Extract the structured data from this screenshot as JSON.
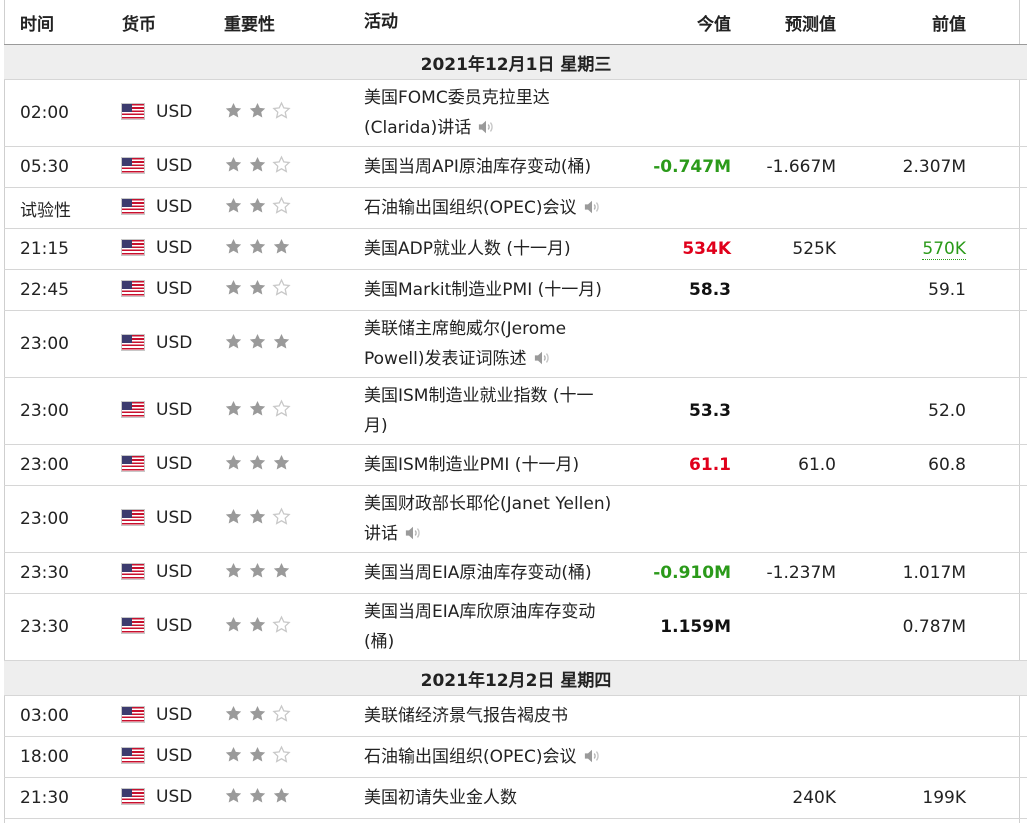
{
  "header": {
    "time": "时间",
    "currency": "货币",
    "importance": "重要性",
    "event": "活动",
    "actual": "今值",
    "forecast": "预测值",
    "previous": "前值"
  },
  "icons": {
    "flag": "us-flag-icon",
    "star_full": "star-filled-icon",
    "star_empty": "star-outline-icon",
    "speaker": "speaker-icon"
  },
  "colors": {
    "red": "#e0001b",
    "green": "#2b9a1a",
    "star_filled": "#9a9a9a",
    "star_empty": "#c8c8c8",
    "date_bg": "#eeeeee"
  },
  "sections": [
    {
      "date": "2021年12月1日  星期三",
      "rows": [
        {
          "time": "02:00",
          "currency": "USD",
          "stars": 2,
          "event": [
            "美国FOMC委员克拉里达",
            "(Clarida)讲话"
          ],
          "speech": true,
          "actual": "",
          "actual_color": "",
          "forecast": "",
          "previous": "",
          "previous_color": ""
        },
        {
          "time": "05:30",
          "currency": "USD",
          "stars": 2,
          "event": [
            "美国当周API原油库存变动(桶)"
          ],
          "speech": false,
          "actual": "-0.747M",
          "actual_color": "green",
          "forecast": "-1.667M",
          "previous": "2.307M",
          "previous_color": ""
        },
        {
          "time": "试验性",
          "currency": "USD",
          "stars": 2,
          "event": [
            "石油输出国组织(OPEC)会议"
          ],
          "speech": true,
          "actual": "",
          "actual_color": "",
          "forecast": "",
          "previous": "",
          "previous_color": ""
        },
        {
          "time": "21:15",
          "currency": "USD",
          "stars": 3,
          "event": [
            "美国ADP就业人数 (十一月)"
          ],
          "speech": false,
          "actual": "534K",
          "actual_color": "red",
          "forecast": "525K",
          "previous": "570K",
          "previous_color": "green-dotted"
        },
        {
          "time": "22:45",
          "currency": "USD",
          "stars": 2,
          "event": [
            "美国Markit制造业PMI (十一月)"
          ],
          "speech": false,
          "actual": "58.3",
          "actual_color": "black",
          "forecast": "",
          "previous": "59.1",
          "previous_color": ""
        },
        {
          "time": "23:00",
          "currency": "USD",
          "stars": 3,
          "event": [
            "美联储主席鲍威尔(Jerome",
            "Powell)发表证词陈述"
          ],
          "speech": true,
          "actual": "",
          "actual_color": "",
          "forecast": "",
          "previous": "",
          "previous_color": ""
        },
        {
          "time": "23:00",
          "currency": "USD",
          "stars": 2,
          "event": [
            "美国ISM制造业就业指数 (十一",
            "月)"
          ],
          "speech": false,
          "actual": "53.3",
          "actual_color": "black",
          "forecast": "",
          "previous": "52.0",
          "previous_color": ""
        },
        {
          "time": "23:00",
          "currency": "USD",
          "stars": 3,
          "event": [
            "美国ISM制造业PMI (十一月)"
          ],
          "speech": false,
          "actual": "61.1",
          "actual_color": "red",
          "forecast": "61.0",
          "previous": "60.8",
          "previous_color": ""
        },
        {
          "time": "23:00",
          "currency": "USD",
          "stars": 2,
          "event": [
            "美国财政部长耶伦(Janet Yellen)",
            "讲话"
          ],
          "speech": true,
          "actual": "",
          "actual_color": "",
          "forecast": "",
          "previous": "",
          "previous_color": ""
        },
        {
          "time": "23:30",
          "currency": "USD",
          "stars": 3,
          "event": [
            "美国当周EIA原油库存变动(桶)"
          ],
          "speech": false,
          "actual": "-0.910M",
          "actual_color": "green",
          "forecast": "-1.237M",
          "previous": "1.017M",
          "previous_color": ""
        },
        {
          "time": "23:30",
          "currency": "USD",
          "stars": 2,
          "event": [
            "美国当周EIA库欣原油库存变动",
            "(桶)"
          ],
          "speech": false,
          "actual": "1.159M",
          "actual_color": "black",
          "forecast": "",
          "previous": "0.787M",
          "previous_color": ""
        }
      ]
    },
    {
      "date": "2021年12月2日  星期四",
      "rows": [
        {
          "time": "03:00",
          "currency": "USD",
          "stars": 2,
          "event": [
            "美联储经济景气报告褐皮书"
          ],
          "speech": false,
          "actual": "",
          "actual_color": "",
          "forecast": "",
          "previous": "",
          "previous_color": "",
          "thick": true
        },
        {
          "time": "18:00",
          "currency": "USD",
          "stars": 2,
          "event": [
            "石油输出国组织(OPEC)会议"
          ],
          "speech": true,
          "actual": "",
          "actual_color": "",
          "forecast": "",
          "previous": "",
          "previous_color": ""
        },
        {
          "time": "21:30",
          "currency": "USD",
          "stars": 3,
          "event": [
            "美国初请失业金人数"
          ],
          "speech": false,
          "actual": "",
          "actual_color": "",
          "forecast": "240K",
          "previous": "199K",
          "previous_color": ""
        }
      ]
    }
  ]
}
